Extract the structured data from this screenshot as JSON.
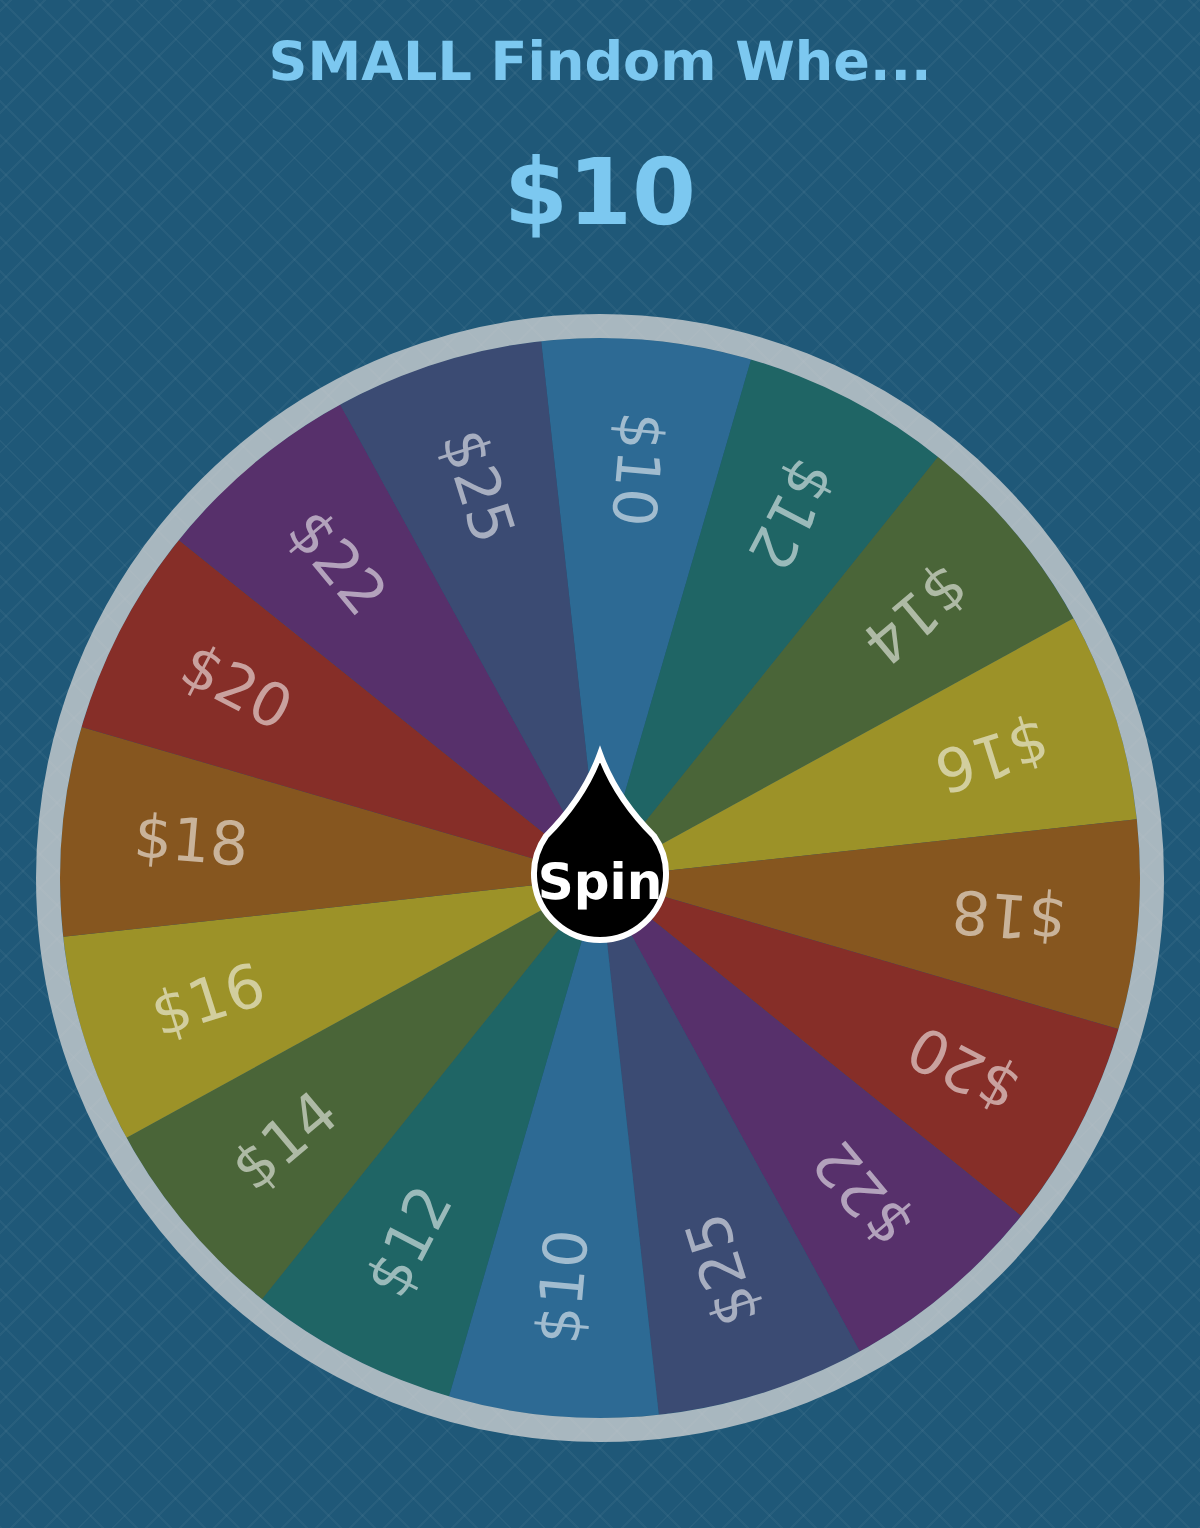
{
  "title": "SMALL Findom Whe...",
  "result": "$10",
  "spin_button": "Spin",
  "wheel": {
    "segments": [
      {
        "label": "$10",
        "color": "#2d6a94"
      },
      {
        "label": "$12",
        "color": "#1f6565"
      },
      {
        "label": "$14",
        "color": "#4a6538"
      },
      {
        "label": "$16",
        "color": "#9c9228"
      },
      {
        "label": "$18",
        "color": "#86561f"
      },
      {
        "label": "$20",
        "color": "#862e28"
      },
      {
        "label": "$22",
        "color": "#57306b"
      },
      {
        "label": "$25",
        "color": "#3b4b73"
      },
      {
        "label": "$10",
        "color": "#2d6a94"
      },
      {
        "label": "$12",
        "color": "#1f6565"
      },
      {
        "label": "$14",
        "color": "#4a6538"
      },
      {
        "label": "$16",
        "color": "#9c9228"
      },
      {
        "label": "$18",
        "color": "#86561f"
      },
      {
        "label": "$20",
        "color": "#862e28"
      },
      {
        "label": "$22",
        "color": "#57306b"
      },
      {
        "label": "$25",
        "color": "#3b4b73"
      }
    ]
  }
}
